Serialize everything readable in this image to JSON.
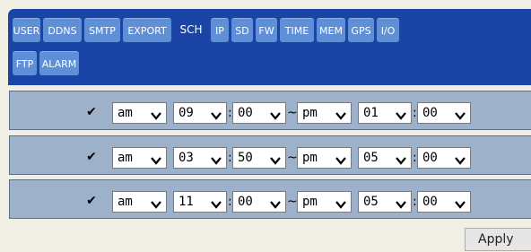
{
  "tabs": [
    {
      "label": "USER",
      "active": false
    },
    {
      "label": "DDNS",
      "active": false
    },
    {
      "label": "SMTP",
      "active": false
    },
    {
      "label": "EXPORT",
      "active": false
    },
    {
      "label": "SCH",
      "active": true
    },
    {
      "label": "IP",
      "active": false
    },
    {
      "label": "SD",
      "active": false
    },
    {
      "label": "FW",
      "active": false
    },
    {
      "label": "TIME",
      "active": false
    },
    {
      "label": "MEM",
      "active": false
    },
    {
      "label": "GPS",
      "active": false
    },
    {
      "label": "I/O",
      "active": false
    },
    {
      "label": "FTP",
      "active": false
    },
    {
      "label": "ALARM",
      "active": false
    }
  ],
  "schedules": [
    {
      "enabled": true,
      "check_glyph": "✔",
      "start_ampm": "am",
      "start_hour": "09",
      "start_min": "00",
      "end_ampm": "pm",
      "end_hour": "01",
      "end_min": "00"
    },
    {
      "enabled": true,
      "check_glyph": "✔",
      "start_ampm": "am",
      "start_hour": "03",
      "start_min": "50",
      "end_ampm": "pm",
      "end_hour": "05",
      "end_min": "00"
    },
    {
      "enabled": true,
      "check_glyph": "✔",
      "start_ampm": "am",
      "start_hour": "11",
      "start_min": "00",
      "end_ampm": "pm",
      "end_hour": "05",
      "end_min": "00"
    }
  ],
  "separators": {
    "colon": ":",
    "range": "~"
  },
  "apply_label": "Apply",
  "colors": {
    "tabbar_bg": "#1a44a5",
    "tab_inactive_bg": "#5f8fd6",
    "row_bg": "#9db1cb",
    "page_bg": "#f1eee4"
  },
  "icons": {
    "dropdown": "chevron-down-icon",
    "checkbox": "checkmark-icon"
  }
}
